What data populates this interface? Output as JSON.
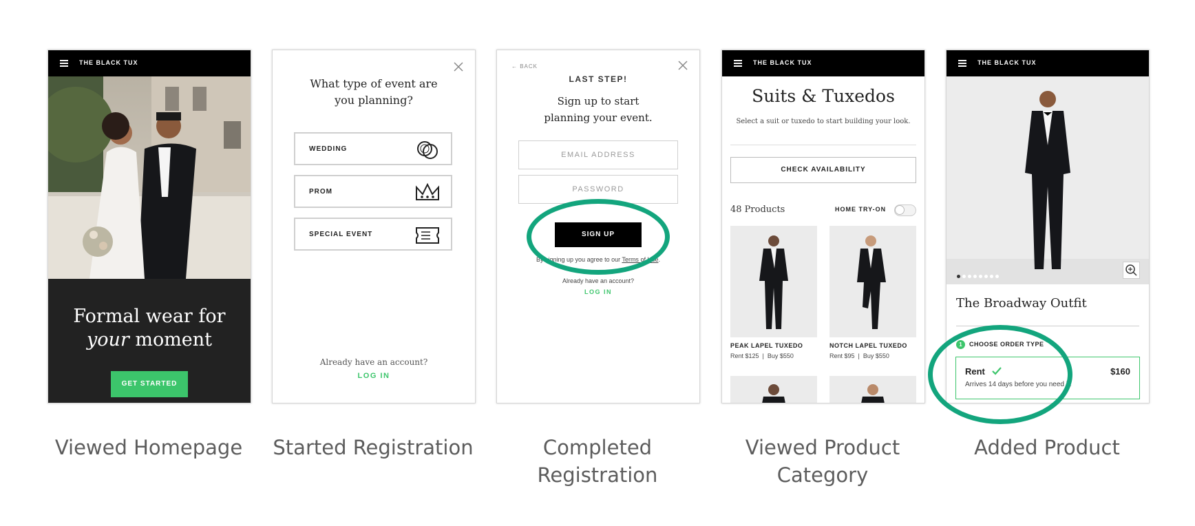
{
  "brand": "THE BLACK TUX",
  "captions": {
    "homepage": "Viewed Homepage",
    "registration": "Started Registration",
    "completed": "Completed Registration",
    "category": "Viewed Product Category",
    "added": "Added Product"
  },
  "home": {
    "headline_line1": "Formal wear for",
    "headline_em": "your",
    "headline_rest": " moment",
    "cta": "GET STARTED"
  },
  "event": {
    "question": "What type of event are you planning?",
    "options": [
      {
        "label": "WEDDING",
        "icon": "rings-icon"
      },
      {
        "label": "PROM",
        "icon": "crown-icon"
      },
      {
        "label": "SPECIAL EVENT",
        "icon": "ticket-icon"
      }
    ],
    "have_account": "Already have an account?",
    "login": "LOG IN"
  },
  "signup": {
    "back": "← BACK",
    "step": "LAST STEP!",
    "heading": "Sign up to start planning your event.",
    "email_placeholder": "EMAIL ADDRESS",
    "password_placeholder": "PASSWORD",
    "button": "SIGN UP",
    "terms_prefix": "By signing up you agree to our ",
    "terms_link": "Terms of Use",
    "terms_suffix": ".",
    "have_account": "Already have an account?",
    "login": "LOG IN"
  },
  "category": {
    "title": "Suits & Tuxedos",
    "subtitle": "Select a suit or tuxedo to start building your look.",
    "check": "CHECK AVAILABILITY",
    "count": "48 Products",
    "home_try": "HOME TRY-ON",
    "products": [
      {
        "name": "PEAK LAPEL TUXEDO",
        "rent": "Rent $125",
        "buy": "Buy $550"
      },
      {
        "name": "NOTCH LAPEL TUXEDO",
        "rent": "Rent $95",
        "buy": "Buy $550"
      }
    ]
  },
  "product": {
    "title": "The Broadway Outfit",
    "step_num": "1",
    "step_label": "CHOOSE ORDER TYPE",
    "option": "Rent",
    "price": "$160",
    "note": "Arrives 14 days before you need it."
  },
  "colors": {
    "green": "#3cc56b",
    "ring": "#13a57d",
    "dark": "#222222"
  }
}
